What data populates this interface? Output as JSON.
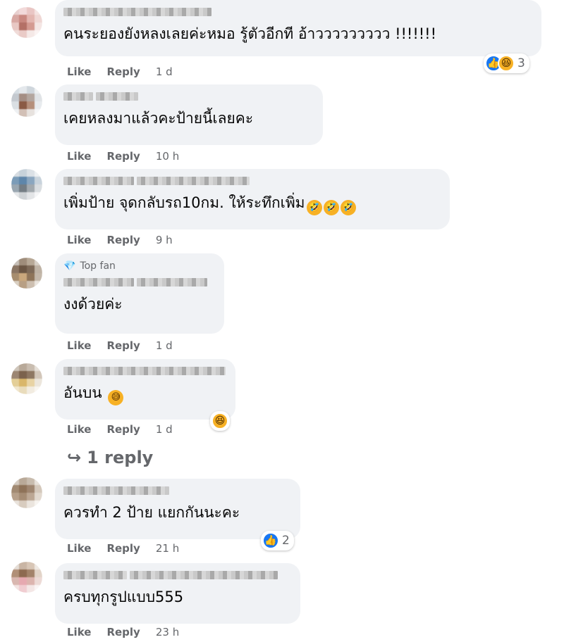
{
  "colors": {
    "bubble": "#f0f2f5",
    "meta": "#65676b",
    "like_blue": "#1877f2",
    "haha_yellow": "#f7b125"
  },
  "labels": {
    "like": "Like",
    "reply": "Reply"
  },
  "comments": [
    {
      "text": "คนระยองยังหลงเลยค่ะหมอ รู้ตัวอีกที อ้าววววววววว !!!!!!!",
      "time": "1 d",
      "reactions": {
        "icons": [
          "like-icon",
          "haha-icon"
        ],
        "count": "3"
      }
    },
    {
      "text": "เคยหลงมาแล้วคะป้ายนี้เลยคะ",
      "time": "10 h"
    },
    {
      "text": "เพิ่มป้าย จุดกลับรถ10กม. ให้ระทึกเพิ่ม",
      "emoji": [
        "rofl-emoji",
        "rofl-emoji",
        "rofl-emoji"
      ],
      "time": "9 h"
    },
    {
      "badge": "Top fan",
      "text": "งงด้วยค่ะ",
      "time": "1 d"
    },
    {
      "text": "อันบน",
      "emoji": [
        "sweat-smile-emoji"
      ],
      "time": "1 d",
      "reactions": {
        "icons": [
          "haha-icon"
        ],
        "count": ""
      }
    },
    {
      "text": "ควรทำ 2 ป้าย แยกกันนะคะ",
      "time": "21 h",
      "reactions": {
        "icons": [
          "like-icon"
        ],
        "count": "2"
      }
    },
    {
      "text": "ครบทุกรูปแบบ555",
      "time": "23 h"
    }
  ],
  "reply_link": {
    "label": "1 reply",
    "icon": "reply-arrow-icon"
  }
}
